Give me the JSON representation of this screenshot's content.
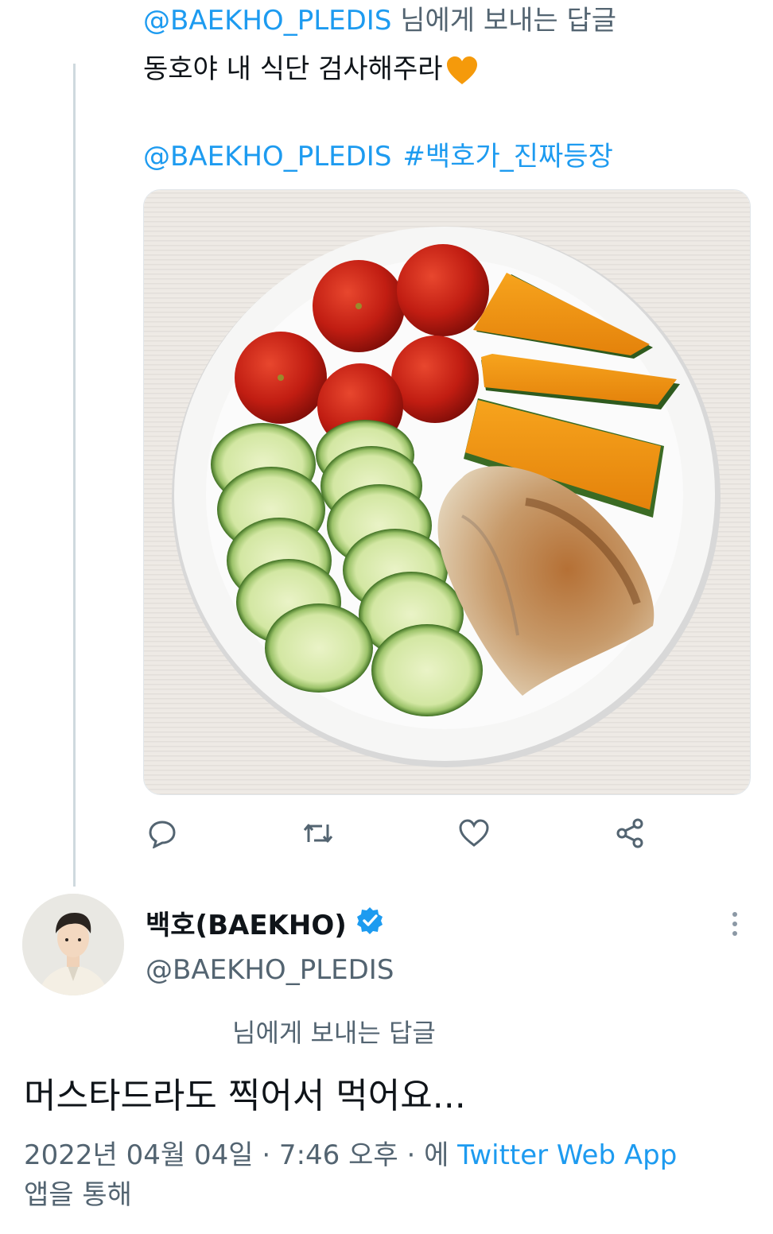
{
  "quoted_tweet": {
    "reply_to_handle": "@BAEKHO_PLEDIS",
    "reply_to_suffix": " 님에게 보내는 답글",
    "text": "동호야 내 식단 검사해주라",
    "mention": "@BAEKHO_PLEDIS",
    "hashtag": "#백호가_진짜등장",
    "media_description": "meal-photo",
    "actions": {
      "reply_icon": "reply-icon",
      "retweet_icon": "retweet-icon",
      "like_icon": "heart-icon",
      "share_icon": "share-icon"
    }
  },
  "reply_tweet": {
    "display_name": "백호(BAEKHO)",
    "verified_icon": "verified-badge-icon",
    "handle": "@BAEKHO_PLEDIS",
    "reply_label": "님에게 보내는 답글",
    "text": "머스타드라도 찍어서 먹어요...",
    "timestamp": "2022년 04월 04일 · 7:46 오후 · 에 ",
    "source": "Twitter Web App",
    "source_suffix": "앱을 통해"
  },
  "colors": {
    "link": "#1d9bf0",
    "secondary_text": "#536471",
    "heart": "#f59a0b"
  }
}
